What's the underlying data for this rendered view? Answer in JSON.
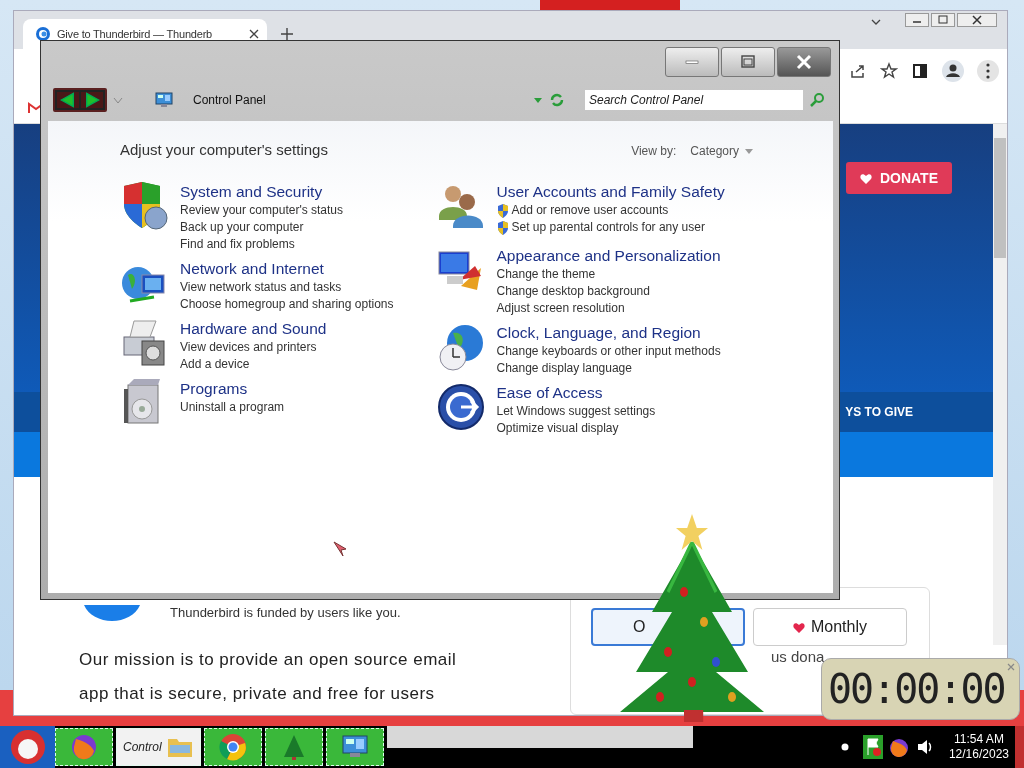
{
  "browser": {
    "tab": {
      "title": "Give to Thunderbird — Thunderb"
    },
    "page": {
      "donate": "DONATE",
      "ways": "YS TO GIVE",
      "funded": "Thunderbird is funded by users like you.",
      "mission": [
        "Our mission is to provide an open source email",
        "app that is secure, private and free for users"
      ],
      "frequency": [
        {
          "label": "O",
          "selected": true
        },
        {
          "label": "Monthly",
          "selected": false
        }
      ],
      "note": "us dona"
    }
  },
  "control_panel": {
    "address": "Control Panel",
    "search": {
      "placeholder": "Search Control Panel"
    },
    "heading": "Adjust your computer's settings",
    "view_by": {
      "label": "View by:",
      "value": "Category"
    },
    "columns": [
      [
        {
          "title": "System and Security",
          "kind": "system",
          "links": [
            {
              "text": "Review your computer's status",
              "shield": false
            },
            {
              "text": "Back up your computer",
              "shield": false
            },
            {
              "text": "Find and fix problems",
              "shield": false
            }
          ]
        },
        {
          "title": "Network and Internet",
          "kind": "network",
          "links": [
            {
              "text": "View network status and tasks",
              "shield": false
            },
            {
              "text": "Choose homegroup and sharing options",
              "shield": false
            }
          ]
        },
        {
          "title": "Hardware and Sound",
          "kind": "hardware",
          "links": [
            {
              "text": "View devices and printers",
              "shield": false
            },
            {
              "text": "Add a device",
              "shield": false
            }
          ]
        },
        {
          "title": "Programs",
          "kind": "programs",
          "links": [
            {
              "text": "Uninstall a program",
              "shield": false
            }
          ]
        }
      ],
      [
        {
          "title": "User Accounts and Family Safety",
          "kind": "users",
          "links": [
            {
              "text": "Add or remove user accounts",
              "shield": true
            },
            {
              "text": "Set up parental controls for any user",
              "shield": true
            }
          ]
        },
        {
          "title": "Appearance and Personalization",
          "kind": "appearance",
          "links": [
            {
              "text": "Change the theme",
              "shield": false
            },
            {
              "text": "Change desktop background",
              "shield": false
            },
            {
              "text": "Adjust screen resolution",
              "shield": false
            }
          ]
        },
        {
          "title": "Clock, Language, and Region",
          "kind": "clock",
          "links": [
            {
              "text": "Change keyboards or other input methods",
              "shield": false
            },
            {
              "text": "Change display language",
              "shield": false
            }
          ]
        },
        {
          "title": "Ease of Access",
          "kind": "access",
          "links": [
            {
              "text": "Let Windows suggest settings",
              "shield": false
            },
            {
              "text": "Optimize visual display",
              "shield": false
            }
          ]
        }
      ]
    ]
  },
  "clock_widget": {
    "time": "00:00:00"
  },
  "taskbar": {
    "task_label": "Control",
    "time": "11:54 AM",
    "date": "12/16/2023"
  }
}
